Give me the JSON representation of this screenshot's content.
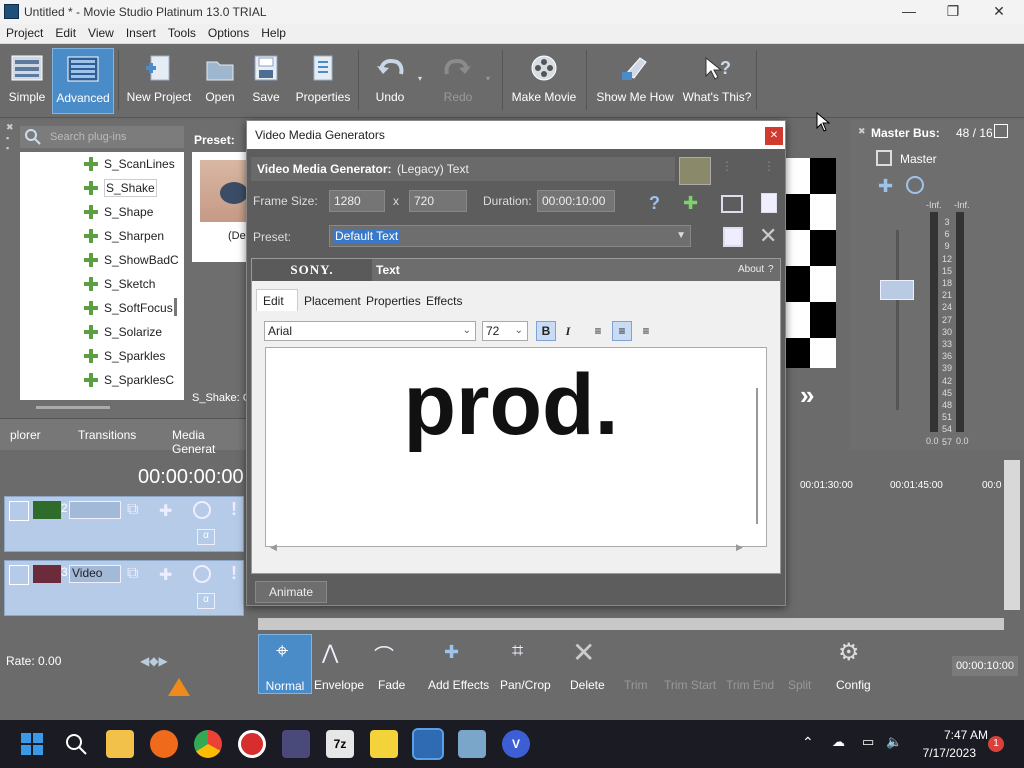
{
  "window": {
    "title": "Untitled * - Movie Studio Platinum 13.0 TRIAL",
    "minimize": "—",
    "maximize": "❐",
    "close": "✕"
  },
  "menu": [
    "Project",
    "Edit",
    "View",
    "Insert",
    "Tools",
    "Options",
    "Help"
  ],
  "toolbar": [
    {
      "label": "Simple",
      "icon": "simple-layout-icon"
    },
    {
      "label": "Advanced",
      "icon": "advanced-layout-icon",
      "active": true
    },
    {
      "label": "New Project",
      "icon": "new-project-icon"
    },
    {
      "label": "Open",
      "icon": "open-folder-icon"
    },
    {
      "label": "Save",
      "icon": "save-disk-icon"
    },
    {
      "label": "Properties",
      "icon": "properties-icon"
    },
    {
      "label": "Undo",
      "icon": "undo-icon"
    },
    {
      "label": "Redo",
      "icon": "redo-icon",
      "disabled": true
    },
    {
      "label": "Make Movie",
      "icon": "film-reel-icon"
    },
    {
      "label": "Show Me How",
      "icon": "hand-pointer-icon"
    },
    {
      "label": "What's This?",
      "icon": "whats-this-icon"
    }
  ],
  "plugins": {
    "search_placeholder": "Search plug-ins",
    "items": [
      "S_ScanLines",
      "S_Shake",
      "S_Shape",
      "S_Sharpen",
      "S_ShowBadC",
      "S_Sketch",
      "S_SoftFocus",
      "S_Solarize",
      "S_Sparkles",
      "S_SparklesC"
    ],
    "selected": "S_Shake",
    "status": "S_Shake: C"
  },
  "preset_label": "Preset:",
  "preset_caption": "(De",
  "left_tabs": [
    "plorer",
    "Transitions",
    "Media Generat"
  ],
  "master": {
    "title": "Master Bus:",
    "value": "48 / 16",
    "channel": "Master",
    "inf_left": "-Inf.",
    "inf_right": "-Inf.",
    "scale": [
      "3",
      "6",
      "9",
      "12",
      "15",
      "18",
      "21",
      "24",
      "27",
      "30",
      "33",
      "36",
      "39",
      "42",
      "45",
      "48",
      "51",
      "54",
      "57"
    ],
    "zero_left": "0.0",
    "zero_right": "0.0"
  },
  "timeline": {
    "timecode": "00:00:00:00",
    "ruler": [
      "00:01:30:00",
      "00:01:45:00",
      "00:0"
    ],
    "tracks": [
      {
        "number": "2",
        "name": ""
      },
      {
        "number": "3",
        "name": "Video"
      }
    ],
    "end_time": "00:00:10:00",
    "rate": "Rate: 0.00"
  },
  "bottom_toolbar": [
    {
      "label": "Normal",
      "active": true
    },
    {
      "label": "Envelope"
    },
    {
      "label": "Fade"
    },
    {
      "label": "Add Effects"
    },
    {
      "label": "Pan/Crop"
    },
    {
      "label": "Delete"
    },
    {
      "label": "Trim",
      "disabled": true
    },
    {
      "label": "Trim Start",
      "disabled": true
    },
    {
      "label": "Trim End",
      "disabled": true
    },
    {
      "label": "Split",
      "disabled": true
    },
    {
      "label": "Config"
    }
  ],
  "dialog": {
    "title": "Video Media Generators",
    "generator_label": "Video Media Generator:",
    "generator_name": "(Legacy) Text",
    "frame_size_label": "Frame Size:",
    "width": "1280",
    "x": "x",
    "height": "720",
    "duration_label": "Duration:",
    "duration": "00:00:10:00",
    "preset_label": "Preset:",
    "preset_value": "Default Text",
    "sony": "SONY.",
    "plugin_name": "Text",
    "about": "About",
    "about_q": "?",
    "tabs": [
      "Edit",
      "Placement",
      "Properties",
      "Effects"
    ],
    "font": "Arial",
    "size": "72",
    "bold": "B",
    "italic": "I",
    "text": "prod.",
    "animate": "Animate"
  },
  "clock": {
    "time": "7:47 AM",
    "date": "7/17/2023",
    "badge": "1"
  },
  "colors": {
    "accent": "#4a8cc7",
    "panel": "#6b6b6b",
    "track": "#b6cbe8",
    "close_red": "#d03a2f"
  }
}
